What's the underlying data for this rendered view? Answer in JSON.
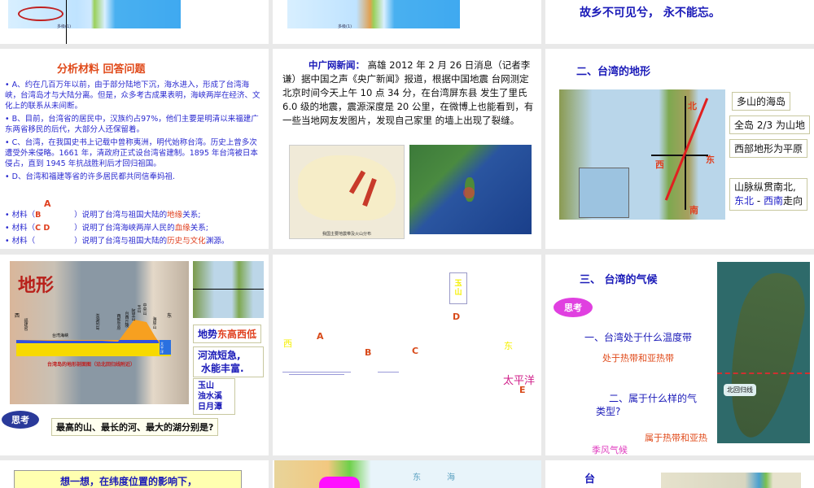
{
  "slide1": {
    "scale_label": "多级(1)"
  },
  "slide2": {
    "scale_label": "多级(1)"
  },
  "slide3": {
    "text": "故乡不可见兮， 永不能忘。"
  },
  "slide4": {
    "title": "分析材料 回答问题",
    "bullets": [
      "A、约在几百万年以前，由于部分陆地下沉，海水进入，形成了台湾海峡，台湾岛才与大陆分离。但是，众多考古成果表明，海峡两岸在经济、文化上的联系从未间断。",
      "B、目前，台湾省的居民中，汉族约占97%，他们主要是明清以来福建广东两省移民的后代，大部分人还保留着。",
      "C、台湾，在我国史书上记载中曾称夷洲，明代始称台湾。历史上曾多次遭受外来侵略。1661 年，清政府正式设台湾省建制。1895 年台湾被日本侵占，直到 1945 年抗战胜利后才回归祖国。",
      "D、台湾和福建等省的许多居民都共同信奉妈祖."
    ],
    "q_prefix": "材料（",
    "q_suffix": "）说明了台湾",
    "questions": [
      {
        "answer": "A",
        "rest1": "与祖国大陆的",
        "key": "地缘",
        "rest2": "关系;"
      },
      {
        "answer": "B",
        "rest1": "海峡两岸人民的",
        "key": "血缘",
        "rest2": "关系;"
      },
      {
        "answer": "C D",
        "rest1": "与祖国大陆的",
        "key": "历史与文化",
        "rest2": "渊源。"
      }
    ]
  },
  "slide5": {
    "heading": "中广网新闻：",
    "body": "高雄 2012 年 2 月 26 日消息（记者李谦）据中国之声《央广新闻》报道，根据中国地震 台网测定北京时间今天上午 10 点 34 分，在台湾屏东县 发生了里氏 6.0 级的地震，震源深度是 20 公里，在微博上也能看到，有一些当地网友发图片，发现自己家里 的墙上出现了裂缝。",
    "map_caption": "我国主要地震带及火山分布"
  },
  "slide6": {
    "title": "二、台湾的地形",
    "directions": {
      "north": "北",
      "south": "南",
      "east": "东",
      "west": "西"
    },
    "facts": [
      "多山的海岛",
      "全岛 2/3 为山地",
      "西部地形为平原"
    ],
    "mountain_line1": "山脉纵贯南北,",
    "mountain_dir_a": "东北",
    "mountain_dash": " - ",
    "mountain_dir_b": "西南",
    "mountain_tail": "走向"
  },
  "slide7": {
    "title": "地形",
    "profile_caption": "台湾岛的地形剖面图（沿北回归线附近）",
    "west": "西",
    "east": "东",
    "peaks": [
      "福建省",
      "澎湖列岛",
      "西部平原",
      "台西丘陵",
      "阿里山",
      "玉山",
      "中央山",
      "海岸山"
    ],
    "strait": "台湾海峡",
    "pacific": "太平洋",
    "terrain": [
      "地势",
      "东高西低"
    ],
    "rivers": [
      "河流短急,",
      "水能丰富."
    ],
    "answers": [
      "玉山",
      "浊水溪",
      "日月潭"
    ],
    "think": "思考",
    "question": "最高的山、最长的河、最大的湖分别是?"
  },
  "slide8": {
    "yushan": "玉山",
    "labels": {
      "west": "西",
      "east": "东",
      "a": "A",
      "b": "B",
      "c": "C",
      "d": "D",
      "e": "E"
    },
    "pacific": "太平洋"
  },
  "slide9": {
    "title": "三、 台湾的气候",
    "think": "思考",
    "q1": "一、台湾处于什么温度带",
    "a1": "处于热带和亚热带",
    "q2a": "二、属于什么样的气",
    "q2b": "类型?",
    "a2a": "属于热带和亚热",
    "a2b": "季风气候",
    "tropic_label": "北回归线"
  },
  "slide10": {
    "text": "想一想，在纬度位置的影响下，"
  },
  "slide11": {
    "labels": [
      "东",
      "海"
    ]
  },
  "slide12": {
    "text": "台"
  }
}
